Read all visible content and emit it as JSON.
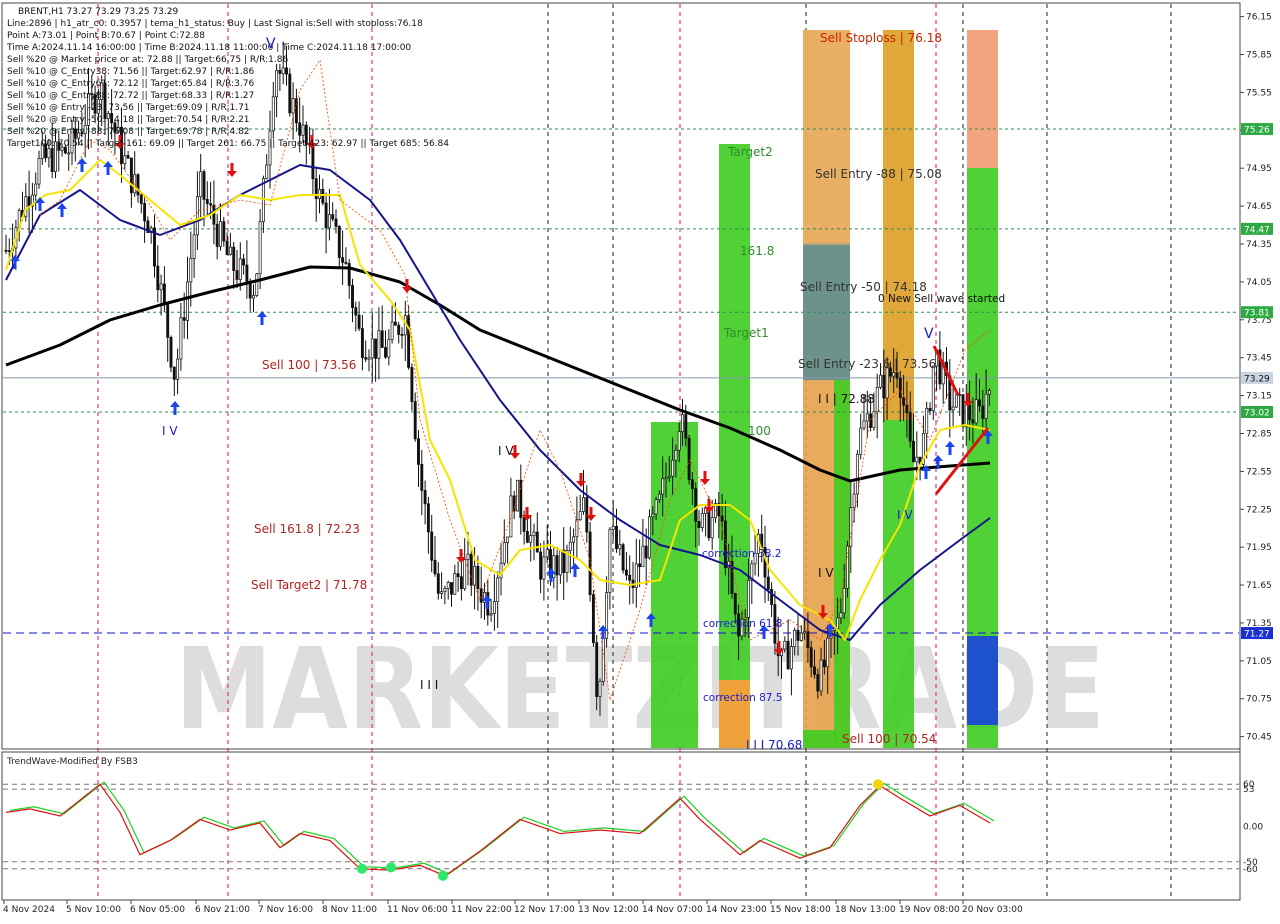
{
  "header": {
    "lines": [
      "BRENT,H1  73.27 73.29 73.25 73.29",
      "Line:2896 | h1_atr_c0: 0.3957 | tema_h1_status: Buy | Last Signal is:Sell with stoploss:76.18",
      "Point A:73.01 | Point B:70.67 | Point C:72.88",
      "Time A:2024.11.14 16:00:00 | Time B:2024.11.18 11:00:00 | Time C:2024.11.18 17:00:00",
      "Sell %20 @ Market price or at: 72.88 || Target:66.75 | R/R:1.86",
      "Sell %10 @ C_Entry38: 71.56 || Target:62.97 | R/R:1.86",
      "Sell %10 @ C_Entry61: 72.12 || Target:65.84 | R/R:3.76",
      "Sell %10 @ C_Entry88: 72.72 || Target:68.33 | R/R:1.27",
      "Sell %10 @ Entry -23: 73.56 || Target:69.09 | R/R:1.71",
      "Sell %20 @ Entry -50: 74.18 || Target:70.54 | R/R:2.21",
      "Sell %20 @ Entry -88: 75.08 || Target:69.78 | R/R:4.82",
      "Target100: 70.54 || Target 161: 69.09 || Target 261: 66.75 || Target 423: 62.97 || Target 685: 56.84"
    ]
  },
  "watermark": "MARKETZITRADE",
  "chart_data": {
    "type": "candlestick",
    "symbol": "BRENT",
    "timeframe": "H1",
    "ylim": [
      70.36,
      76.25
    ],
    "price_ticks": [
      "76.15",
      "75.85",
      "75.55",
      "75.25",
      "74.95",
      "74.65",
      "74.35",
      "74.05",
      "73.75",
      "73.45",
      "73.15",
      "72.85",
      "72.55",
      "72.25",
      "71.95",
      "71.65",
      "71.35",
      "71.05",
      "70.75",
      "70.45"
    ],
    "time_ticks": [
      "4 Nov 2024",
      "5 Nov 10:00",
      "6 Nov 05:00",
      "6 Nov 21:00",
      "7 Nov 16:00",
      "8 Nov 11:00",
      "11 Nov 06:00",
      "11 Nov 22:00",
      "12 Nov 17:00",
      "13 Nov 12:00",
      "14 Nov 07:00",
      "14 Nov 23:00",
      "15 Nov 18:00",
      "18 Nov 13:00",
      "19 Nov 08:00",
      "20 Nov 03:00"
    ],
    "horizontal_levels": [
      {
        "price": 75.26,
        "label": "75.26",
        "style": "dashed",
        "color": "#2e8b57"
      },
      {
        "price": 74.47,
        "label": "74.47",
        "style": "dashed",
        "color": "#2e8b57"
      },
      {
        "price": 73.81,
        "label": "73.81",
        "style": "dashed",
        "color": "#2e8b57"
      },
      {
        "price": 73.02,
        "label": "73.02",
        "style": "dashed",
        "color": "#2e8b57"
      },
      {
        "price": 71.27,
        "label": "71.27",
        "style": "dashed",
        "color": "#1010cc"
      },
      {
        "price": 73.29,
        "label": "73.29",
        "style": "solid",
        "color": "#8899aa"
      }
    ],
    "annotations": [
      {
        "text": "Sell Stoploss | 76.18",
        "color": "#cc2200"
      },
      {
        "text": "Sell Entry -88 | 75.08",
        "color": "#333333"
      },
      {
        "text": "Sell Entry -50 | 74.18",
        "color": "#333333"
      },
      {
        "text": "0 New Sell wave started",
        "color": "#111111"
      },
      {
        "text": "Sell Entry -23.6 | 73.56",
        "color": "#333333"
      },
      {
        "text": "I I | 72.88",
        "color": "#111111"
      },
      {
        "text": "Target2",
        "color": "#2e8b2e"
      },
      {
        "text": "161.8",
        "color": "#2e8b2e"
      },
      {
        "text": "Target1",
        "color": "#2e8b2e"
      },
      {
        "text": "100",
        "color": "#2e8b2e"
      },
      {
        "text": "Sell 100 | 73.56",
        "color": "#b22222"
      },
      {
        "text": "Sell 161.8 | 72.23",
        "color": "#b22222"
      },
      {
        "text": "Sell Target2 | 71.78",
        "color": "#b22222"
      },
      {
        "text": "correction 38.2",
        "color": "#1a1acc"
      },
      {
        "text": "correction 61.8",
        "color": "#1a1acc"
      },
      {
        "text": "correction 87.5",
        "color": "#1a1acc"
      },
      {
        "text": "I I I 70.68",
        "color": "#1a1acc"
      },
      {
        "text": "Sell 100 | 70.54",
        "color": "#b22222"
      },
      {
        "text": "I V",
        "color": "#1a1acc"
      },
      {
        "text": "I V",
        "color": "#111111"
      },
      {
        "text": "I V",
        "color": "#1a1acc"
      },
      {
        "text": "I V",
        "color": "#111111"
      },
      {
        "text": "I I I",
        "color": "#111111"
      },
      {
        "text": "V",
        "color": "#1a1acc"
      },
      {
        "text": "V",
        "color": "#1a1acc"
      }
    ],
    "indicator": {
      "title": "TrendWave-Modified By FSB3",
      "ticks": [
        "60",
        "53",
        "0.00",
        "-50",
        "-60"
      ],
      "ylim": [
        -100,
        100
      ],
      "series": []
    }
  }
}
